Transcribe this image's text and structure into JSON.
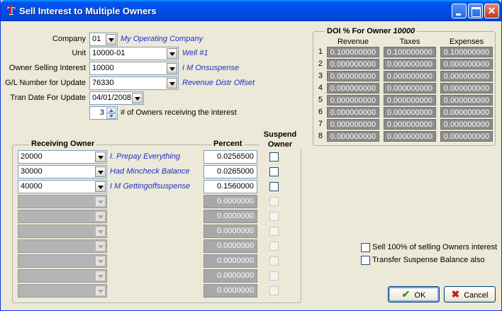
{
  "window": {
    "title": "Sell Interest to Multiple Owners"
  },
  "form": {
    "company": {
      "label": "Company",
      "value": "01",
      "info": "My Operating Company"
    },
    "unit": {
      "label": "Unit",
      "value": "10000-01",
      "info": "Well #1"
    },
    "owner": {
      "label": "Owner Selling Interest",
      "value": "10000",
      "info": "I M Onsuspense"
    },
    "gl": {
      "label": "G/L Number for Update",
      "value": "76330",
      "info": "Revenue Distr Offset"
    },
    "tran_date": {
      "label": "Tran Date For Update",
      "value": "04/01/2008"
    },
    "owner_count": {
      "value": "3",
      "label": "# of Owners receiving the interest"
    }
  },
  "doi": {
    "title_prefix": "DOI % For Owner",
    "title_owner": "10000",
    "headers": [
      "Revenue",
      "Taxes",
      "Expenses"
    ],
    "rows": [
      {
        "no": "1",
        "values": [
          "0.100000000",
          "0.100000000",
          "0.100000000"
        ]
      },
      {
        "no": "2",
        "values": [
          "0.000000000",
          "0.000000000",
          "0.000000000"
        ]
      },
      {
        "no": "3",
        "values": [
          "0.000000000",
          "0.000000000",
          "0.000000000"
        ]
      },
      {
        "no": "4",
        "values": [
          "0.000000000",
          "0.000000000",
          "0.000000000"
        ]
      },
      {
        "no": "5",
        "values": [
          "0.000000000",
          "0.000000000",
          "0.000000000"
        ]
      },
      {
        "no": "6",
        "values": [
          "0.000000000",
          "0.000000000",
          "0.000000000"
        ]
      },
      {
        "no": "7",
        "values": [
          "0.000000000",
          "0.000000000",
          "0.000000000"
        ]
      },
      {
        "no": "8",
        "values": [
          "0.000000000",
          "0.000000000",
          "0.000000000"
        ]
      }
    ]
  },
  "receiving": {
    "headers": {
      "owner": "Receiving Owner",
      "percent": "Percent",
      "suspend": "Suspend Owner"
    },
    "rows": [
      {
        "owner": "20000",
        "name": "I. Prepay Everything",
        "percent": "0.0256500",
        "suspend": false,
        "enabled": true
      },
      {
        "owner": "30000",
        "name": "Had Mincheck Balance",
        "percent": "0.0265000",
        "suspend": false,
        "enabled": true
      },
      {
        "owner": "40000",
        "name": "I M Gettingoffsuspense",
        "percent": "0.1560000",
        "suspend": false,
        "enabled": true
      },
      {
        "owner": "",
        "name": "",
        "percent": "0.0000000",
        "suspend": false,
        "enabled": false
      },
      {
        "owner": "",
        "name": "",
        "percent": "0.0000000",
        "suspend": false,
        "enabled": false
      },
      {
        "owner": "",
        "name": "",
        "percent": "0.0000000",
        "suspend": false,
        "enabled": false
      },
      {
        "owner": "",
        "name": "",
        "percent": "0.0000000",
        "suspend": false,
        "enabled": false
      },
      {
        "owner": "",
        "name": "",
        "percent": "0.0000000",
        "suspend": false,
        "enabled": false
      },
      {
        "owner": "",
        "name": "",
        "percent": "0.0000000",
        "suspend": false,
        "enabled": false
      },
      {
        "owner": "",
        "name": "",
        "percent": "0.0000000",
        "suspend": false,
        "enabled": false
      }
    ]
  },
  "options": {
    "sell_all": {
      "label": "Sell 100% of selling Owners interest",
      "checked": false
    },
    "transfer_suspense": {
      "label": "Transfer Suspense Balance also",
      "checked": false
    }
  },
  "buttons": {
    "ok": "OK",
    "cancel": "Cancel"
  },
  "colors": {
    "title_bar": "#0053ee",
    "info_text": "#2030c8",
    "disabled_field": "#a8a8a8",
    "window_bg": "#ece9d8"
  }
}
